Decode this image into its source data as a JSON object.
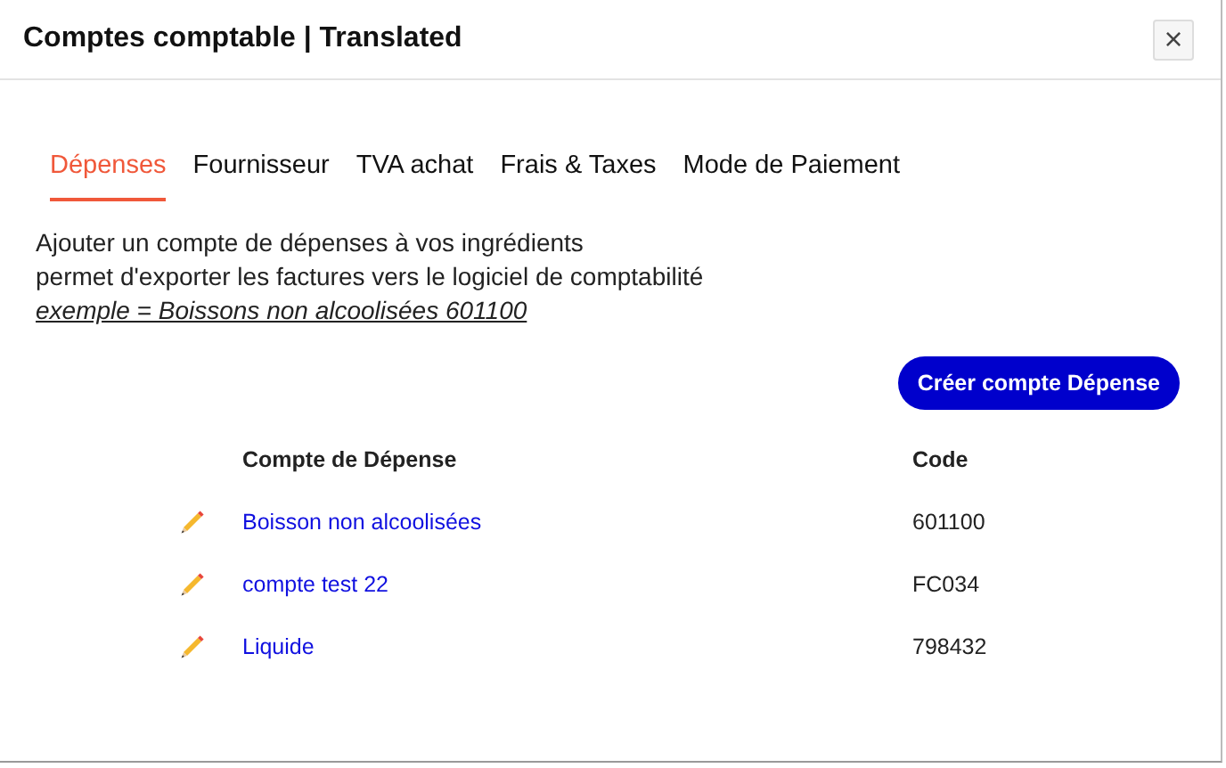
{
  "window": {
    "title": "Comptes comptable | Translated",
    "close": "×"
  },
  "tabs": [
    {
      "label": "Dépenses",
      "selected": true
    },
    {
      "label": "Fournisseur",
      "selected": false
    },
    {
      "label": "TVA achat",
      "selected": false
    },
    {
      "label": "Frais & Taxes",
      "selected": false
    },
    {
      "label": "Mode de Paiement",
      "selected": false
    }
  ],
  "description": [
    "Ajouter un compte de dépenses à vos ingrédients",
    "permet d'exporter les factures vers le logiciel de comptabilité"
  ],
  "example": "exemple = Boissons non alcoolisées 601100",
  "create_button": "Créer compte Dépense",
  "table": {
    "columns": [
      "Compte de Dépense",
      "Code"
    ],
    "rows": [
      {
        "name": "Boisson non alcoolisées",
        "code": "601100"
      },
      {
        "name": "compte test 22",
        "code": "FC034"
      },
      {
        "name": "Liquide",
        "code": "798432"
      }
    ]
  }
}
